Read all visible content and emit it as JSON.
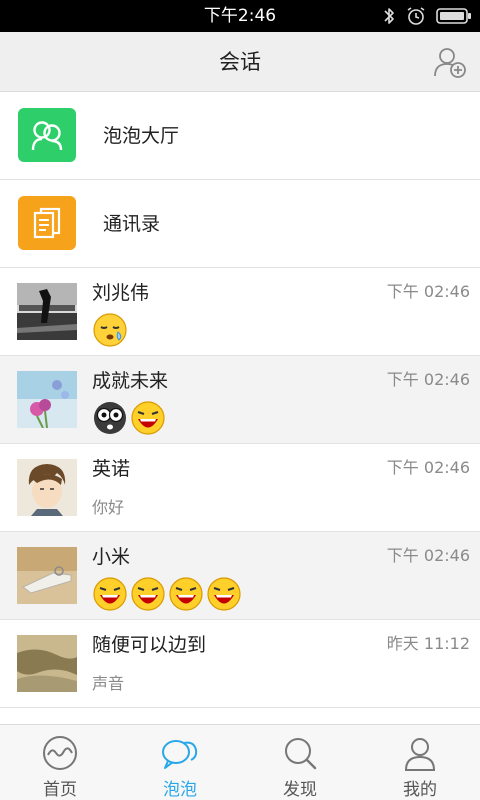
{
  "status_bar": {
    "time": "下午2:46"
  },
  "header": {
    "title": "会话"
  },
  "entries": [
    {
      "label": "泡泡大厅",
      "color": "#2ecf6a",
      "icon": "group-chat-icon"
    },
    {
      "label": "通讯录",
      "color": "#f7a21b",
      "icon": "contacts-book-icon"
    }
  ],
  "conversations": [
    {
      "name": "刘兆伟",
      "time": "下午 02:46",
      "preview_text": "",
      "preview_emojis": [
        "sleepy-face-emoji"
      ]
    },
    {
      "name": "成就未来",
      "time": "下午 02:46",
      "preview_text": "",
      "preview_emojis": [
        "goggle-eyes-emoji",
        "laughing-face-emoji"
      ]
    },
    {
      "name": "英诺",
      "time": "下午 02:46",
      "preview_text": "你好",
      "preview_emojis": []
    },
    {
      "name": "小米",
      "time": "下午 02:46",
      "preview_text": "",
      "preview_emojis": [
        "laughing-face-emoji",
        "laughing-face-emoji",
        "laughing-face-emoji",
        "laughing-face-emoji"
      ]
    },
    {
      "name": "随便可以边到",
      "time": "昨天 11:12",
      "preview_text": "声音",
      "preview_emojis": []
    }
  ],
  "nav": {
    "active": "泡泡",
    "accent": "#2aa7e8",
    "tabs": [
      {
        "label": "首页",
        "icon": "home-wave-icon"
      },
      {
        "label": "泡泡",
        "icon": "chat-bubbles-icon"
      },
      {
        "label": "发现",
        "icon": "search-icon"
      },
      {
        "label": "我的",
        "icon": "profile-icon"
      }
    ]
  }
}
